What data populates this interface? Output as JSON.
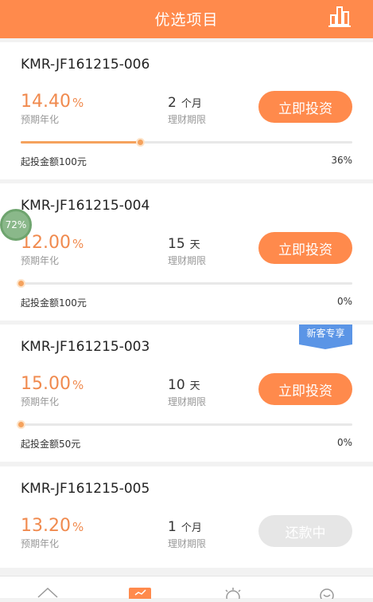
{
  "header": {
    "title": "优选项目",
    "chart_icon": "bar-chart-icon"
  },
  "float_badge": "72%",
  "labels": {
    "rate": "预期年化",
    "term": "理财期限"
  },
  "projects": [
    {
      "name": "KMR-JF161215-006",
      "rate": "14.40",
      "rate_unit": "%",
      "term": "2",
      "term_unit": "个月",
      "button": "立即投资",
      "min_amount": "起投金额100元",
      "progress": "36%",
      "progress_value": 0.36
    },
    {
      "name": "KMR-JF161215-004",
      "rate": "12.00",
      "rate_unit": "%",
      "term": "15",
      "term_unit": "天",
      "button": "立即投资",
      "min_amount": "起投金额100元",
      "progress": "0%",
      "progress_value": 0
    },
    {
      "name": "KMR-JF161215-003",
      "badge": "新客专享",
      "rate": "15.00",
      "rate_unit": "%",
      "term": "10",
      "term_unit": "天",
      "button": "立即投资",
      "min_amount": "起投金额50元",
      "progress": "0%",
      "progress_value": 0
    },
    {
      "name": "KMR-JF161215-005",
      "rate": "13.20",
      "rate_unit": "%",
      "term": "1",
      "term_unit": "个月",
      "button": "还款中"
    }
  ],
  "colors": {
    "accent": "#ff8a4c",
    "rate": "#f08a4e",
    "badge": "#5b95e6",
    "disabled": "#e6e6e6"
  },
  "tabbar": {
    "icons": [
      "home-icon",
      "invest-icon",
      "discover-icon",
      "account-icon"
    ]
  }
}
